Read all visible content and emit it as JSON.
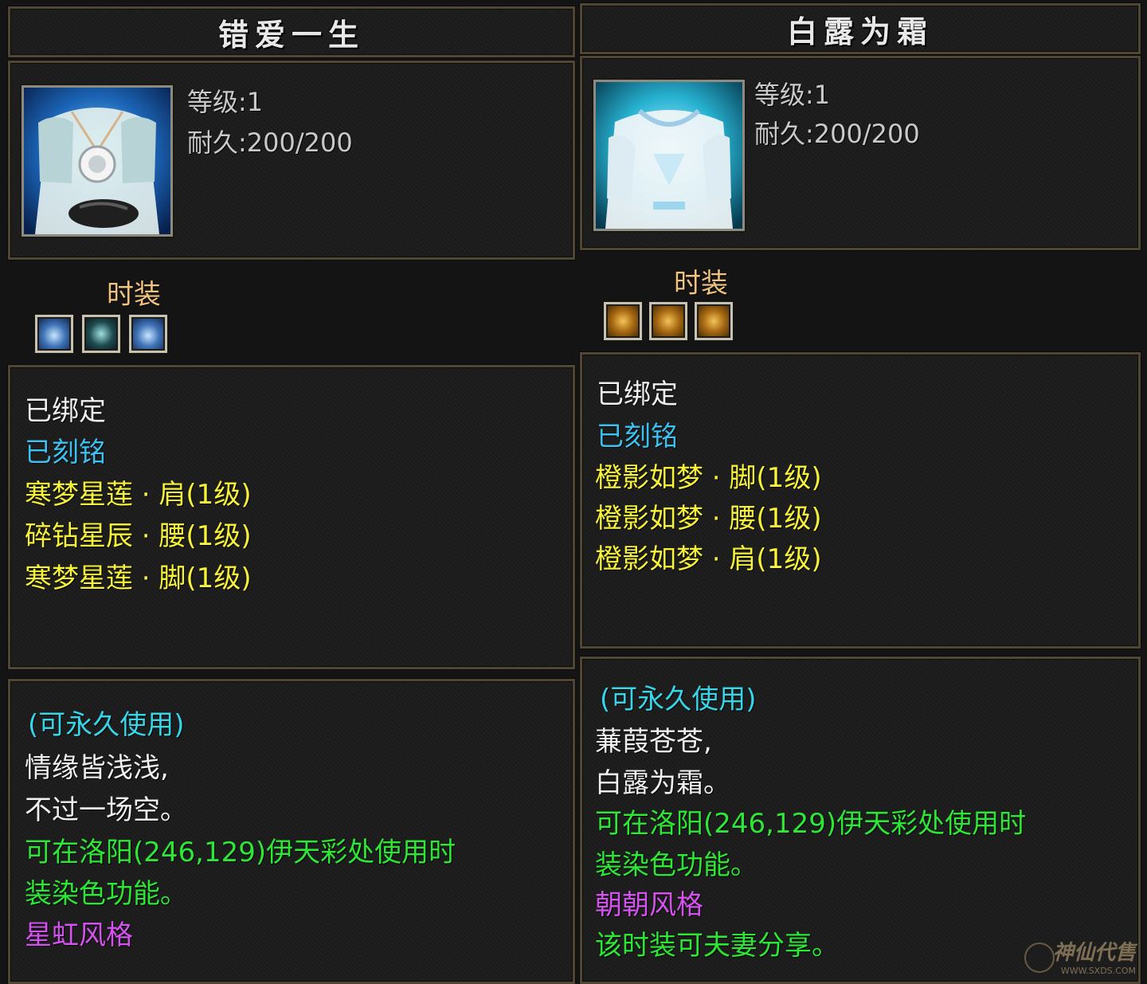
{
  "colors": {
    "frame": "#4f4636",
    "title": "#e8e8e8",
    "section_label": "#f0c47f",
    "bound": "#f0f0f0",
    "engraved": "#3ec0ee",
    "set_item": "#f7f23a",
    "description": "#f0f0f0",
    "usage": "#2ee636",
    "style": "#d452ee",
    "permanent": "#38d5e8"
  },
  "items": [
    {
      "title": "错爱一生",
      "level": "等级:1",
      "durability": "耐久:200/200",
      "section_label": "时装",
      "slot_icons": [
        "blue-gem-icon",
        "sparkle-gem-icon",
        "blue-gem-icon"
      ],
      "bound": "已绑定",
      "engraved": "已刻铭",
      "set_items": [
        "寒梦星莲 · 肩(1级)",
        "碎钻星辰 · 腰(1级)",
        "寒梦星莲 · 脚(1级)"
      ],
      "permanent": "(可永久使用)",
      "description": [
        "情缘皆浅浅,",
        "不过一场空。"
      ],
      "usage": [
        "可在洛阳(246,129)伊天彩处使用时",
        "装染色功能。"
      ],
      "style": "星虹风格",
      "share": ""
    },
    {
      "title": "白露为霜",
      "level": "等级:1",
      "durability": "耐久:200/200",
      "section_label": "时装",
      "slot_icons": [
        "amber-gem-icon",
        "amber-gem-icon",
        "amber-gem-icon"
      ],
      "bound": "已绑定",
      "engraved": "已刻铭",
      "set_items": [
        "橙影如梦 · 脚(1级)",
        "橙影如梦 · 腰(1级)",
        "橙影如梦 · 肩(1级)"
      ],
      "permanent": "(可永久使用)",
      "description": [
        "蒹葭苍苍,",
        "白露为霜。"
      ],
      "usage": [
        "可在洛阳(246,129)伊天彩处使用时",
        "装染色功能。"
      ],
      "style": "朝朝风格",
      "share": "该时装可夫妻分享。"
    }
  ],
  "watermark": {
    "text": "神仙代售",
    "url": "WWW.SXDS.COM"
  }
}
